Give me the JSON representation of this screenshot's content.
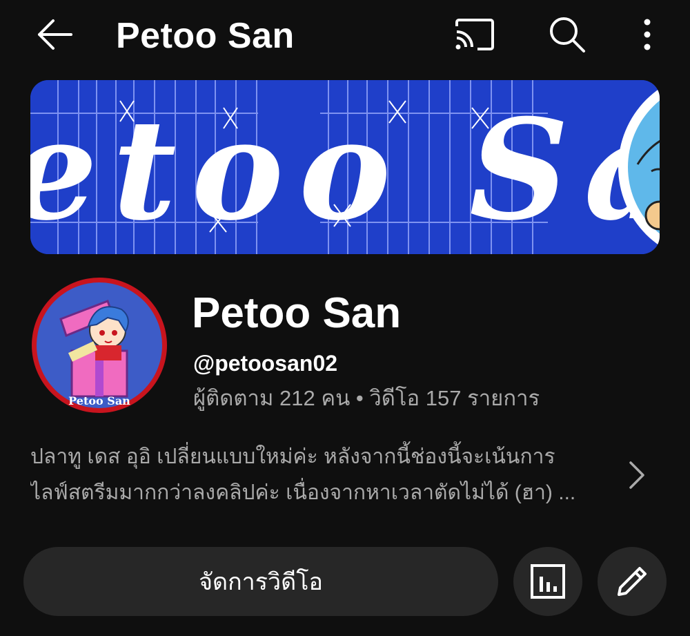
{
  "header": {
    "title": "Petoo San",
    "icons": {
      "back": "arrow-left-icon",
      "cast": "cast-icon",
      "search": "search-icon",
      "more": "more-vertical-icon"
    }
  },
  "banner": {
    "text": "etoo San"
  },
  "channel": {
    "name": "Petoo San",
    "handle": "@petoosan02",
    "stats": "ผู้ติดตาม 212 คน • วิดีโอ 157 รายการ",
    "avatar_text": "Petoo San",
    "description_line1": "ปลาทู เดส อุอิ เปลี่ยนแบบใหม่ค่ะ หลังจากนี้ช่องนี้จะเน้นการ",
    "description_line2": "ไลฟ์สตรีมมากกว่าลงคลิปค่ะ เนื่องจากหาเวลาตัดไม่ได้ (ฮา) ..."
  },
  "actions": {
    "manage_label": "จัดการวิดีโอ",
    "analytics_icon": "analytics-icon",
    "edit_icon": "pencil-icon"
  },
  "colors": {
    "background": "#0f0f0f",
    "banner_blue": "#1f3fc9",
    "button_bg": "#272727",
    "secondary_text": "#aaaaaa",
    "avatar_ring": "#c8141e"
  }
}
